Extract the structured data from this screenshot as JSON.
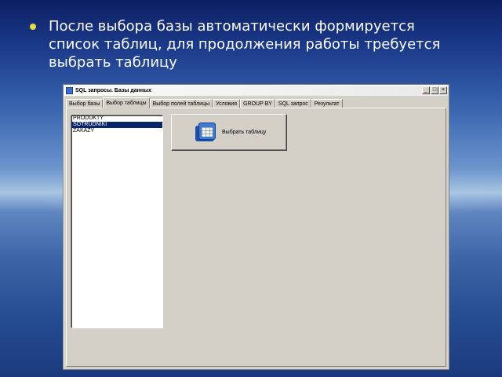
{
  "slide": {
    "lines": [
      "После выбора базы автоматически формируется",
      "список таблиц, для продолжения работы требуется",
      "выбрать таблицу"
    ]
  },
  "window": {
    "title": "SQL запросы. Базы данных",
    "controls": {
      "minimize": "_",
      "maximize": "□",
      "close": "×"
    },
    "tabs": [
      "Выбор базы",
      "Выбор таблицы",
      "Выбор полей таблицы",
      "Условия",
      "GROUP BY",
      "SQL запрос",
      "Результат"
    ],
    "active_tab": "Выбор таблицы",
    "tables": [
      "PRODUKTY",
      "SOTRUDNIKI",
      "ZAKAZY"
    ],
    "selected_table": "SOTRUDNIKI",
    "select_button_label": "Выбрать таблицу"
  },
  "colors": {
    "bullet": "#e8d94a",
    "selection": "#0a246a",
    "dialog_face": "#d4d0c8"
  },
  "icons": {
    "select_button": "table-icon"
  }
}
